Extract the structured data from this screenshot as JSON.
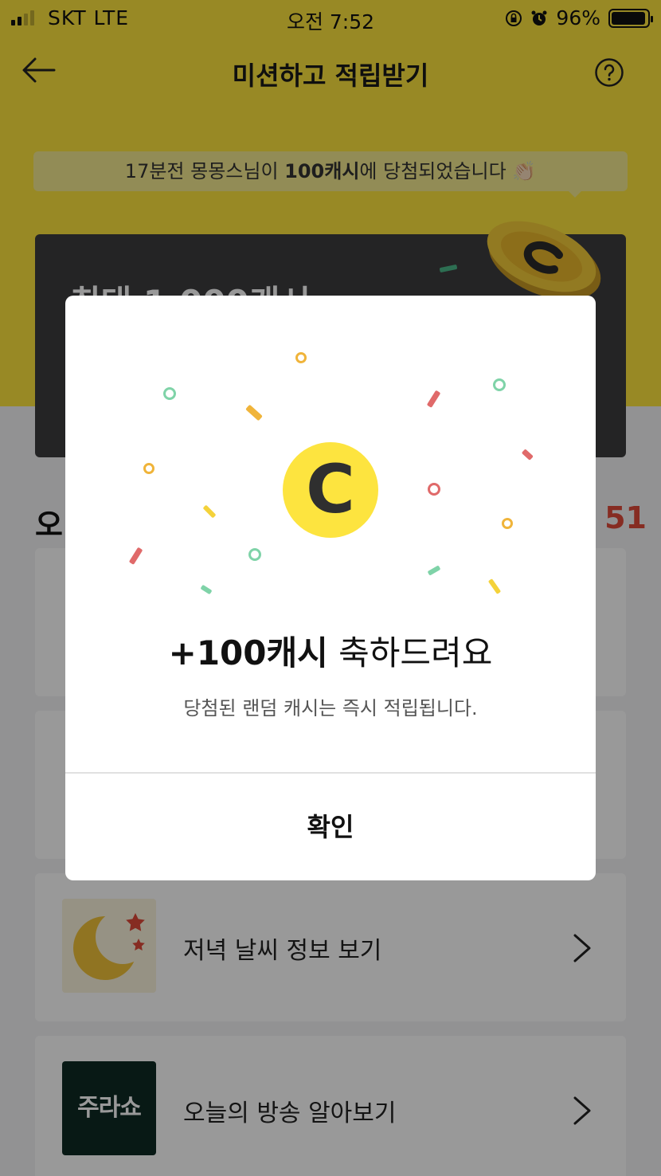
{
  "status_bar": {
    "carrier": "SKT  LTE",
    "time": "오전 7:52",
    "battery": "96%"
  },
  "nav": {
    "title": "미션하고 적립받기"
  },
  "ticker": {
    "prefix": "17분전 몽몽스님이 ",
    "amount": "100캐시",
    "suffix": "에 당첨되었습니다 👏🏻"
  },
  "promo": {
    "headline": "최대 1,000캐시"
  },
  "section": {
    "title": "오",
    "count": "51"
  },
  "missions": [
    {
      "label": ""
    },
    {
      "label": ""
    },
    {
      "label": "저녁 날씨 정보 보기",
      "icon": "moon-icon"
    },
    {
      "label": "오늘의 방송 알아보기",
      "icon": "tv-logo",
      "logo_text": "주라쇼"
    }
  ],
  "modal": {
    "amount": "+100캐시",
    "message": " 축하드려요",
    "subtitle": "당첨된 랜덤 캐시는 즉시 적립됩니다.",
    "confirm_label": "확인",
    "coin_letter": "C"
  },
  "colors": {
    "brand_yellow": "#fde43f",
    "accent_red": "#e04a3a",
    "coin_yellow": "#fde43f"
  }
}
